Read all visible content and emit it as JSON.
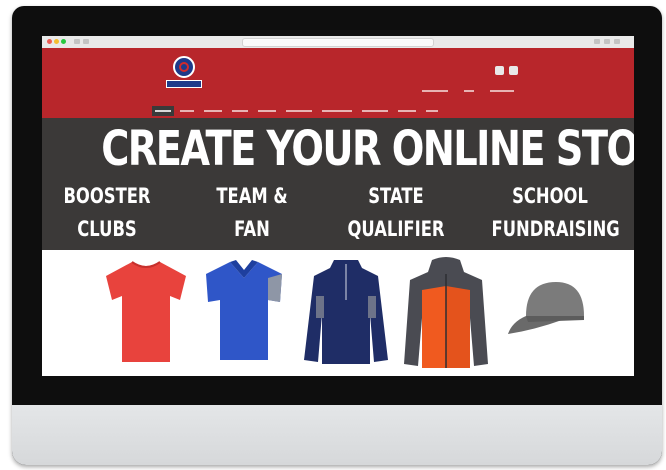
{
  "banner": {
    "headline": "CREATE YOUR ONLINE STORE",
    "categories": [
      {
        "line1": "BOOSTER",
        "line2": "CLUBS"
      },
      {
        "line1": "TEAM &",
        "line2": "FAN"
      },
      {
        "line1": "STATE",
        "line2": "QUALIFIER"
      },
      {
        "line1": "SCHOOL",
        "line2": "FUNDRAISING"
      }
    ]
  },
  "colors": {
    "header_red": "#b8262b",
    "banner_dark": "#3b3938",
    "tee_red": "#e8433d",
    "polo_blue": "#2f56c8",
    "jacket_navy": "#1f2d66",
    "hoodie_orange": "#f05a1f",
    "cap_gray": "#7b7b7b"
  },
  "products": [
    {
      "icon": "red-tshirt-icon"
    },
    {
      "icon": "blue-polo-icon"
    },
    {
      "icon": "navy-quarter-zip-icon"
    },
    {
      "icon": "orange-hooded-jacket-icon"
    },
    {
      "icon": "gray-cap-icon"
    }
  ]
}
